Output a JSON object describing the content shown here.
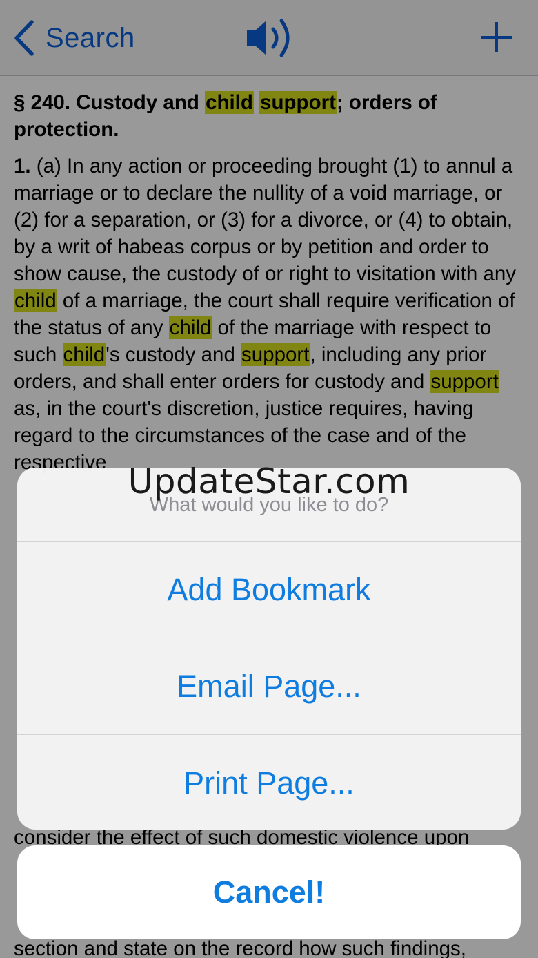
{
  "navbar": {
    "back_label": "Search"
  },
  "document": {
    "heading": {
      "prefix": "§ 240. Custody and ",
      "hl1": "child",
      "sp": " ",
      "hl2": "support",
      "suffix": "; orders of protection."
    },
    "para_num": "1.",
    "body": {
      "s1": " (a) In any action or proceeding brought (1) to annul a marriage or to declare the nullity of a void marriage, or (2) for a separation, or (3) for a divorce, or (4) to obtain, by a writ of habeas corpus or by petition and order to show cause, the custody of or right to visitation with any ",
      "h1": "child",
      "s2": " of a marriage, the court shall require verification of the status of any ",
      "h2": "child",
      "s3": " of the marriage with respect to such ",
      "h3": "child",
      "s4": "'s custody and ",
      "h4": "support",
      "s5": ", including any prior orders, and shall enter orders for custody and ",
      "h5": "support",
      "s6": " as, in the court's discretion, justice requires, having regard to the circumstances of the case and of the respective"
    },
    "partial_line_1": "consider the effect of such domestic violence upon",
    "partial_line_2": "section and state on the record how such findings,"
  },
  "watermark": "UpdateStar.com",
  "action_sheet": {
    "title": "What would you like to do?",
    "buttons": [
      "Add Bookmark",
      "Email Page...",
      "Print Page..."
    ],
    "cancel_label": "Cancel!"
  },
  "colors": {
    "accent": "#0f7ddf",
    "highlight": "#d7e020",
    "navbar_bg": "#f7f7f7"
  }
}
